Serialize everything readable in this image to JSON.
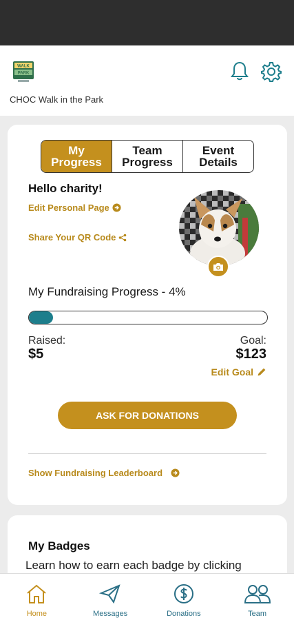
{
  "header": {
    "app_title": "CHOC Walk in the Park",
    "logo_text_top": "WALK",
    "logo_text_bottom": "PARK"
  },
  "tabs": [
    {
      "label": "My\nProgress",
      "active": true
    },
    {
      "label": "Team\nProgress",
      "active": false
    },
    {
      "label": "Event\nDetails",
      "active": false
    }
  ],
  "profile": {
    "greeting": "Hello charity!",
    "edit_page_label": "Edit Personal Page",
    "share_qr_label": "Share Your QR Code"
  },
  "progress": {
    "title": "My Fundraising Progress - 4%",
    "percent": 4,
    "raised_label": "Raised:",
    "raised_value": "$5",
    "goal_label": "Goal:",
    "goal_value": "$123",
    "edit_goal_label": "Edit Goal"
  },
  "actions": {
    "ask_button": "ASK FOR DONATIONS",
    "leaderboard_link": "Show Fundraising Leaderboard"
  },
  "badges": {
    "title": "My Badges",
    "description": "Learn how to earn each badge by clicking"
  },
  "bottom_nav": [
    {
      "label": "Home",
      "icon": "home-icon",
      "active": true
    },
    {
      "label": "Messages",
      "icon": "paper-plane-icon",
      "active": false
    },
    {
      "label": "Donations",
      "icon": "dollar-circle-icon",
      "active": false
    },
    {
      "label": "Team",
      "icon": "team-icon",
      "active": false
    }
  ],
  "colors": {
    "accent": "#c4901e",
    "progress_fill": "#1d7e8c",
    "nav_inactive": "#2a6f86"
  }
}
